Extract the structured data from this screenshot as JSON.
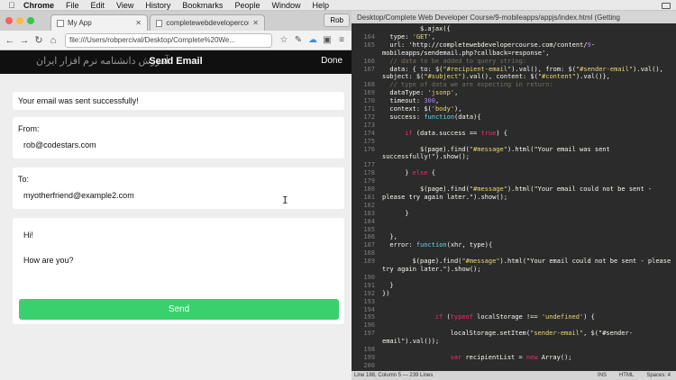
{
  "menubar": {
    "items": [
      "Chrome",
      "File",
      "Edit",
      "View",
      "History",
      "Bookmarks",
      "People",
      "Window",
      "Help"
    ]
  },
  "browser": {
    "tabs": [
      {
        "label": "My App",
        "active": true
      },
      {
        "label": "completewebdevelopercou...",
        "active": false
      }
    ],
    "profile": "Rob",
    "url": "file:///Users/robpercival/Desktop/Complete%20We..."
  },
  "app": {
    "header_title": "Send Email",
    "done_label": "Done",
    "watermark": "آموزش دانشنامه نرم افزار ایران",
    "message": "Your email was sent successfully!",
    "from_label": "From:",
    "from_value": "rob@codestars.com",
    "to_label": "To:",
    "to_value": "myotherfriend@example2.com",
    "body_line1": "Hi!",
    "body_line2": "How are you?",
    "send_label": "Send",
    "send_color": "#38d16e"
  },
  "editor": {
    "title": "Desktop/Complete Web Developer Course/9-mobileapps/appjs/index.html (Getting",
    "status_left": "Line 188, Column 5 — 239 Lines",
    "status_ins": "INS",
    "status_lang": "HTML",
    "status_spaces": "Spaces: 4",
    "lines": [
      {
        "n": "",
        "text": "$.ajax({",
        "indent": 10
      },
      {
        "n": "164",
        "text": "type: 'GET',",
        "indent": 2
      },
      {
        "n": "165",
        "text": "url: 'http://completewebdevelopercourse.com/content/9-",
        "indent": 2
      },
      {
        "n": "",
        "text": "mobileapps/sendemail.php?callback=response',",
        "indent": 0
      },
      {
        "n": "166",
        "text": "// data to be added to query string:",
        "indent": 2
      },
      {
        "n": "167",
        "text": "data: { to: $(\"#recipient-email\").val(), from: $(\"#sender-email\").val(),",
        "indent": 2
      },
      {
        "n": "",
        "text": "subject: $(\"#subject\").val(), content: $(\"#content\").val()},",
        "indent": 0
      },
      {
        "n": "168",
        "text": "// type of data we are expecting in return:",
        "indent": 2
      },
      {
        "n": "169",
        "text": "dataType: 'jsonp',",
        "indent": 2
      },
      {
        "n": "170",
        "text": "timeout: 300,",
        "indent": 2
      },
      {
        "n": "171",
        "text": "context: $('body'),",
        "indent": 2
      },
      {
        "n": "172",
        "text": "success: function(data){",
        "indent": 2
      },
      {
        "n": "173",
        "text": "",
        "indent": 0
      },
      {
        "n": "174",
        "text": "if (data.success == true) {",
        "indent": 6
      },
      {
        "n": "175",
        "text": "",
        "indent": 0
      },
      {
        "n": "176",
        "text": "$(page).find(\"#message\").html(\"Your email was sent",
        "indent": 10
      },
      {
        "n": "",
        "text": "successfully!\").show();",
        "indent": 0
      },
      {
        "n": "177",
        "text": "",
        "indent": 0
      },
      {
        "n": "178",
        "text": "} else {",
        "indent": 6
      },
      {
        "n": "179",
        "text": "",
        "indent": 0
      },
      {
        "n": "180",
        "text": "$(page).find(\"#message\").html(\"Your email could not be sent -",
        "indent": 10
      },
      {
        "n": "181",
        "text": "please try again later.\").show();",
        "indent": 0
      },
      {
        "n": "182",
        "text": "",
        "indent": 0
      },
      {
        "n": "183",
        "text": "}",
        "indent": 6
      },
      {
        "n": "184",
        "text": "",
        "indent": 0
      },
      {
        "n": "185",
        "text": "",
        "indent": 0
      },
      {
        "n": "186",
        "text": "},",
        "indent": 2
      },
      {
        "n": "187",
        "text": "error: function(xhr, type){",
        "indent": 2
      },
      {
        "n": "188",
        "text": "",
        "indent": 0
      },
      {
        "n": "189",
        "text": "$(page).find(\"#message\").html(\"Your email could not be sent - please",
        "indent": 8
      },
      {
        "n": "",
        "text": "try again later.\").show();",
        "indent": 0
      },
      {
        "n": "190",
        "text": "",
        "indent": 0
      },
      {
        "n": "191",
        "text": "}",
        "indent": 2
      },
      {
        "n": "192",
        "text": "})",
        "indent": 0
      },
      {
        "n": "193",
        "text": "",
        "indent": 0
      },
      {
        "n": "194",
        "text": "",
        "indent": 0
      },
      {
        "n": "195",
        "text": "if (typeof localStorage !== 'undefined') {",
        "indent": 14
      },
      {
        "n": "196",
        "text": "",
        "indent": 0
      },
      {
        "n": "197",
        "text": "localStorage.setItem(\"sender-email\", $(\"#sender-",
        "indent": 18
      },
      {
        "n": "",
        "text": "email\").val());",
        "indent": 0
      },
      {
        "n": "198",
        "text": "",
        "indent": 0
      },
      {
        "n": "199",
        "text": "var recipientList = new Array();",
        "indent": 18
      },
      {
        "n": "200",
        "text": "",
        "indent": 0
      }
    ]
  },
  "colors": {
    "editor_bg": "#2b2b2b",
    "header_bg": "#101010"
  }
}
